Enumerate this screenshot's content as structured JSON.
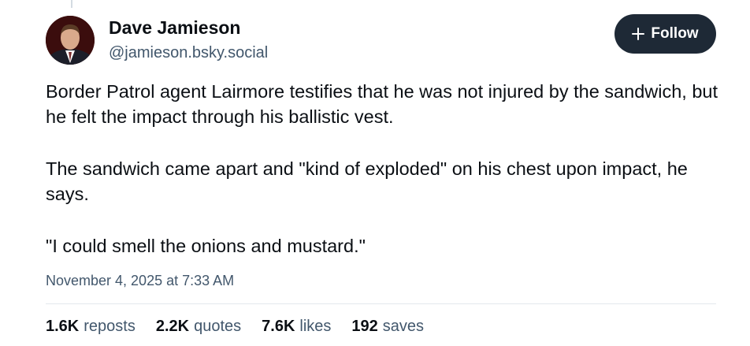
{
  "author": {
    "name": "Dave Jamieson",
    "handle": "@jamieson.bsky.social"
  },
  "follow_button": {
    "label": "Follow",
    "icon": "plus-icon"
  },
  "post": {
    "paragraphs": [
      "Border Patrol agent Lairmore testifies that he was not injured by the sandwich, but he felt the impact through his ballistic vest.",
      "The sandwich came apart and \"kind of exploded\" on his chest upon impact, he says.",
      "\"I could smell the onions and mustard.\""
    ],
    "timestamp": "November 4, 2025 at 7:33 AM"
  },
  "stats": [
    {
      "count": "1.6K",
      "label": "reposts"
    },
    {
      "count": "2.2K",
      "label": "quotes"
    },
    {
      "count": "7.6K",
      "label": "likes"
    },
    {
      "count": "192",
      "label": "saves"
    }
  ],
  "colors": {
    "follow_bg": "#1e2936",
    "secondary_text": "#42576c",
    "primary_text": "#0b0f14"
  }
}
